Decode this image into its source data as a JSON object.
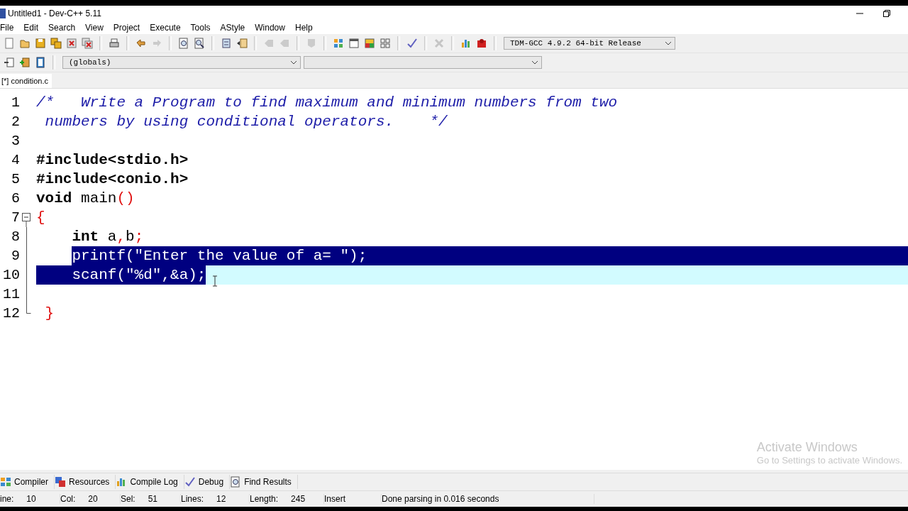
{
  "window": {
    "title": "Untitled1 - Dev-C++ 5.11"
  },
  "menu": [
    "File",
    "Edit",
    "Search",
    "View",
    "Project",
    "Execute",
    "Tools",
    "AStyle",
    "Window",
    "Help"
  ],
  "toolbar_main": [
    {
      "kind": "new",
      "disabled": false
    },
    {
      "kind": "open",
      "disabled": false
    },
    {
      "kind": "save",
      "disabled": false
    },
    {
      "kind": "saveall",
      "disabled": false
    },
    {
      "kind": "close",
      "disabled": false
    },
    {
      "kind": "closeall",
      "disabled": false
    },
    {
      "kind": "sep"
    },
    {
      "kind": "print",
      "disabled": false
    },
    {
      "kind": "sep"
    },
    {
      "kind": "undo",
      "disabled": false
    },
    {
      "kind": "redo",
      "disabled": true
    },
    {
      "kind": "sep"
    },
    {
      "kind": "find",
      "disabled": false
    },
    {
      "kind": "replace",
      "disabled": false
    },
    {
      "kind": "sep"
    },
    {
      "kind": "indent",
      "disabled": false
    },
    {
      "kind": "unindent",
      "disabled": false
    },
    {
      "kind": "sep"
    },
    {
      "kind": "back",
      "disabled": true
    },
    {
      "kind": "back",
      "disabled": true
    },
    {
      "kind": "sep"
    },
    {
      "kind": "bookmark",
      "disabled": true
    },
    {
      "kind": "sep"
    },
    {
      "kind": "tiles",
      "disabled": false
    },
    {
      "kind": "window",
      "disabled": false
    },
    {
      "kind": "colors",
      "disabled": false
    },
    {
      "kind": "grid",
      "disabled": false
    },
    {
      "kind": "sep"
    },
    {
      "kind": "check",
      "disabled": false
    },
    {
      "kind": "sep"
    },
    {
      "kind": "cross",
      "disabled": true
    },
    {
      "kind": "sep"
    },
    {
      "kind": "chart",
      "disabled": false
    },
    {
      "kind": "profile",
      "disabled": false
    }
  ],
  "compiler_select": {
    "value": "TDM-GCC 4.9.2 64-bit Release"
  },
  "toolbar_project": [
    {
      "kind": "project-new",
      "disabled": false
    },
    {
      "kind": "project-add",
      "disabled": false
    },
    {
      "kind": "project-remove",
      "disabled": false
    }
  ],
  "scope_select": {
    "value": "(globals)"
  },
  "tabs": [
    {
      "label": "[*] condition.c",
      "selected": true
    }
  ],
  "editor": {
    "lines": [
      {
        "number": "1",
        "tokens": [
          {
            "text": "/*   Write a Program to find maximum and minimum numbers from two",
            "kind": "comment",
            "selected": false
          }
        ]
      },
      {
        "number": "2",
        "tokens": [
          {
            "text": " numbers by using conditional operators.    */",
            "kind": "comment",
            "selected": false
          }
        ]
      },
      {
        "number": "3"
      },
      {
        "number": "4",
        "tokens": [
          {
            "text": "#include<stdio.h>",
            "kind": "preprocessor",
            "selected": false
          }
        ]
      },
      {
        "number": "5",
        "tokens": [
          {
            "text": "#include<conio.h>",
            "kind": "preprocessor",
            "selected": false
          }
        ]
      },
      {
        "number": "6",
        "tokens": [
          {
            "text": "void",
            "kind": "keyword",
            "selected": false
          },
          {
            "text": " main",
            "kind": "plain",
            "selected": false
          },
          {
            "text": "()",
            "kind": "symbol",
            "selected": false
          }
        ]
      },
      {
        "number": "7",
        "fold_start": true,
        "tokens": [
          {
            "text": "{",
            "kind": "symbol",
            "selected": false
          }
        ]
      },
      {
        "number": "8",
        "in_fold": true,
        "indented": true,
        "tokens": [
          {
            "text": "int",
            "kind": "keyword",
            "selected": false
          },
          {
            "text": " a",
            "kind": "plain",
            "selected": false
          },
          {
            "text": ",",
            "kind": "symbol",
            "selected": false
          },
          {
            "text": "b",
            "kind": "plain",
            "selected": false
          },
          {
            "text": ";",
            "kind": "symbol",
            "selected": false
          }
        ]
      },
      {
        "number": "9",
        "in_fold": true,
        "indented": true,
        "eol_selected": true,
        "tokens": [
          {
            "text": "printf(\"Enter the value of a= \");",
            "kind": "plain",
            "selected": true
          }
        ]
      },
      {
        "number": "10",
        "in_fold": true,
        "current": true,
        "tokens": [
          {
            "text": "    scanf(\"%d\",&a);",
            "kind": "plain",
            "selected": true
          }
        ]
      },
      {
        "number": "11",
        "in_fold": true
      },
      {
        "number": "12",
        "fold_end": true,
        "tokens": [
          {
            "text": " }",
            "kind": "symbol",
            "selected": false
          }
        ]
      }
    ]
  },
  "os_notice": {
    "title": "Activate Windows",
    "subtitle": "Go to Settings to activate Windows."
  },
  "bottom_tabs": [
    {
      "label": "Compiler",
      "kind": "compiler"
    },
    {
      "label": "Resources",
      "kind": "resources"
    },
    {
      "label": "Compile Log",
      "kind": "log"
    },
    {
      "label": "Debug",
      "kind": "debug"
    },
    {
      "label": "Find Results",
      "kind": "find"
    }
  ],
  "status_bar": [
    {
      "label": "ine:",
      "value": "10"
    },
    {
      "label": "Col:",
      "value": "20"
    },
    {
      "label": "Sel:",
      "value": "51"
    },
    {
      "label": "Lines:",
      "value": "12"
    },
    {
      "label": "Length:",
      "value": "245"
    },
    {
      "value": "Insert"
    },
    {
      "value": "Done parsing in 0.016 seconds"
    }
  ]
}
